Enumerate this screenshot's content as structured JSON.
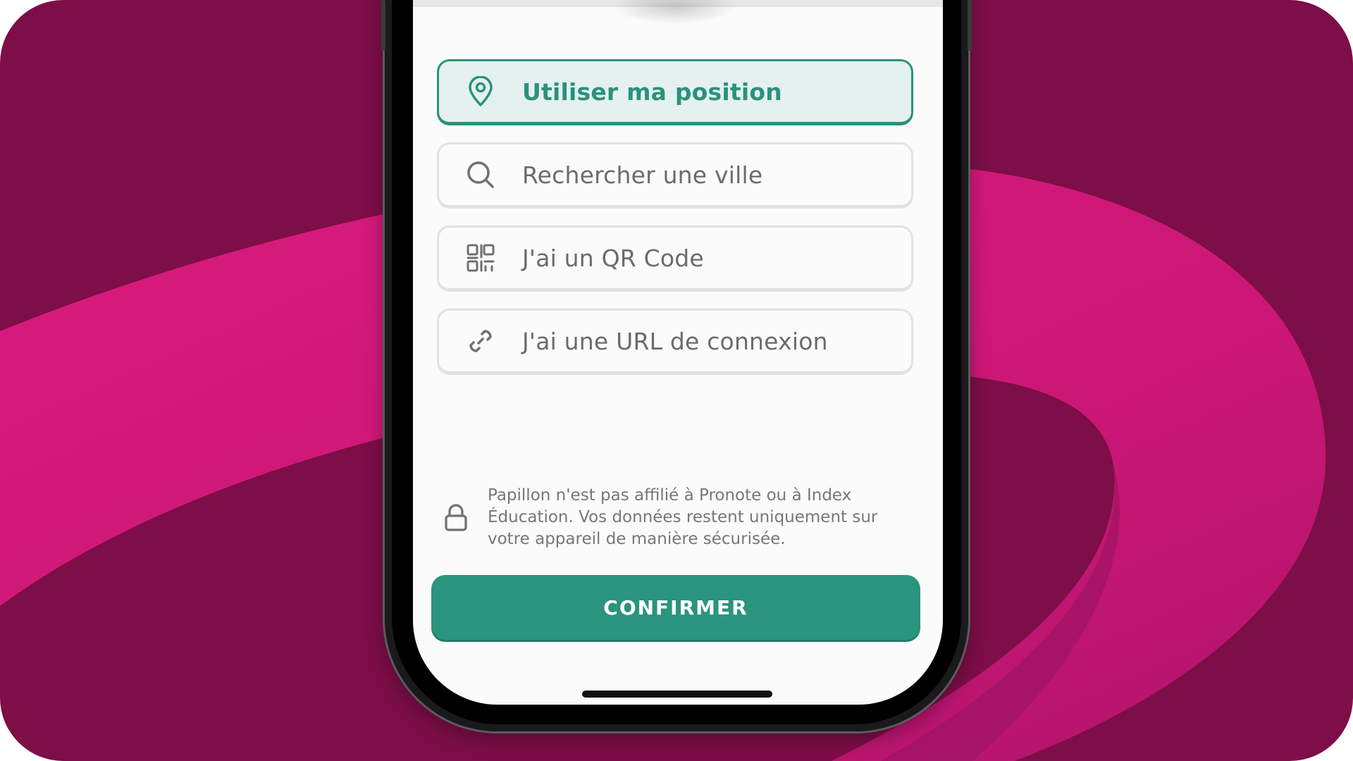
{
  "colors": {
    "background_dark": "#7d0e47",
    "background_pink": "#d81b7c",
    "accent_green": "#2b917d",
    "active_fill": "#e4f1ee",
    "text_gray": "#6b6b6b"
  },
  "options": [
    {
      "label": "Utiliser ma position",
      "icon": "location-pin-icon",
      "active": true
    },
    {
      "label": "Rechercher une ville",
      "icon": "search-icon",
      "active": false
    },
    {
      "label": "J'ai un QR Code",
      "icon": "qr-code-icon",
      "active": false
    },
    {
      "label": "J'ai une URL de connexion",
      "icon": "link-icon",
      "active": false
    }
  ],
  "disclaimer": {
    "icon": "lock-icon",
    "text": "Papillon n'est pas affilié à Pronote ou à Index Éducation. Vos données restent uniquement sur votre appareil de manière sécurisée."
  },
  "confirm_button": {
    "label": "CONFIRMER"
  }
}
